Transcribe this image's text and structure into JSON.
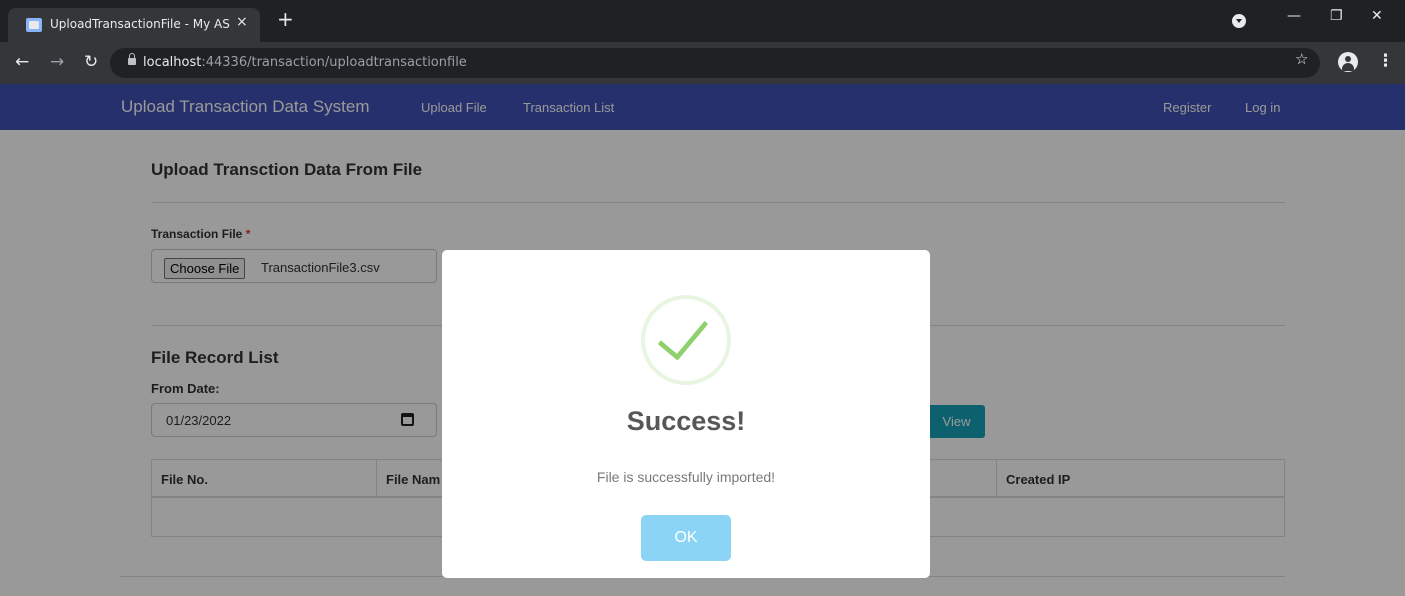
{
  "browser": {
    "tab_title": "UploadTransactionFile - My ASP.N",
    "tab_close": "×",
    "new_tab": "+",
    "url_host": "localhost",
    "url_path": ":44336/transaction/uploadtransactionfile",
    "icons": [
      "favicon-icon",
      "close-tab-icon",
      "new-tab-icon",
      "profile-dropdown-icon",
      "minimize-icon",
      "restore-icon",
      "close-window-icon",
      "back-icon",
      "forward-icon",
      "reload-icon",
      "lock-icon",
      "star-icon",
      "avatar-icon",
      "menu-icon"
    ]
  },
  "navbar": {
    "brand": "Upload Transaction Data System",
    "links": [
      "Upload File",
      "Transaction List"
    ],
    "right_links": [
      "Register",
      "Log in"
    ],
    "color": "#3f51b5"
  },
  "upload": {
    "title": "Upload Transction Data From File",
    "label": "Transaction File",
    "required_mark": "*",
    "choose_button": "Choose File",
    "file_name": "TransactionFile3.csv"
  },
  "records": {
    "title": "File Record List",
    "from_label": "From Date:",
    "from_value": "01/23/2022",
    "view_button": "View",
    "columns": [
      "File No.",
      "File Nam",
      "Created IP"
    ]
  },
  "modal": {
    "title": "Success!",
    "message": "File is successfully imported!",
    "ok_button": "OK",
    "icon": "check-icon",
    "accent": "#8cd4f5"
  }
}
